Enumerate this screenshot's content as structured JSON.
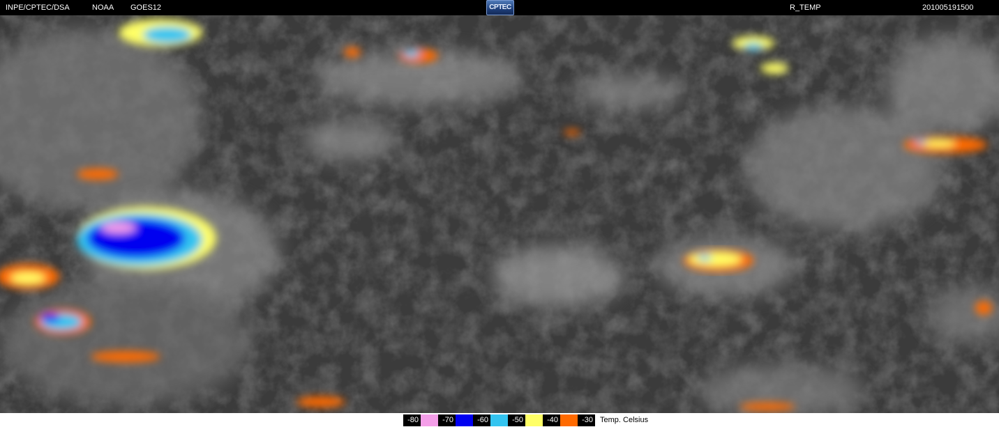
{
  "header": {
    "institution": "INPE/CPTEC/DSA",
    "agency": "NOAA",
    "satellite": "GOES12",
    "logo_text": "CPTEC",
    "product": "R_TEMP",
    "timestamp": "201005191500"
  },
  "legend": {
    "caption": "Temp. Celsius",
    "items": [
      {
        "label": "-80",
        "color": "#000000",
        "text_color": "#ffffff"
      },
      {
        "label": "",
        "color": "#f49ee8",
        "text_color": "#000000"
      },
      {
        "label": "-70",
        "color": "#000000",
        "text_color": "#ffffff"
      },
      {
        "label": "",
        "color": "#0000f0",
        "text_color": "#ffffff"
      },
      {
        "label": "-60",
        "color": "#000000",
        "text_color": "#ffffff"
      },
      {
        "label": "",
        "color": "#33c4f0",
        "text_color": "#000000"
      },
      {
        "label": "-50",
        "color": "#000000",
        "text_color": "#ffffff"
      },
      {
        "label": "",
        "color": "#ffff66",
        "text_color": "#000000"
      },
      {
        "label": "-40",
        "color": "#000000",
        "text_color": "#ffffff"
      },
      {
        "label": "",
        "color": "#ff6a00",
        "text_color": "#000000"
      },
      {
        "label": "-30",
        "color": "#000000",
        "text_color": "#ffffff"
      }
    ]
  },
  "colors": {
    "background_earth": "#3b3b3b",
    "cloud_gray": "#9a9a9a",
    "pink": "#f49ee8",
    "blue": "#0000f0",
    "cyan": "#33c4f0",
    "yellow": "#ffff66",
    "orange": "#ff6a00"
  }
}
